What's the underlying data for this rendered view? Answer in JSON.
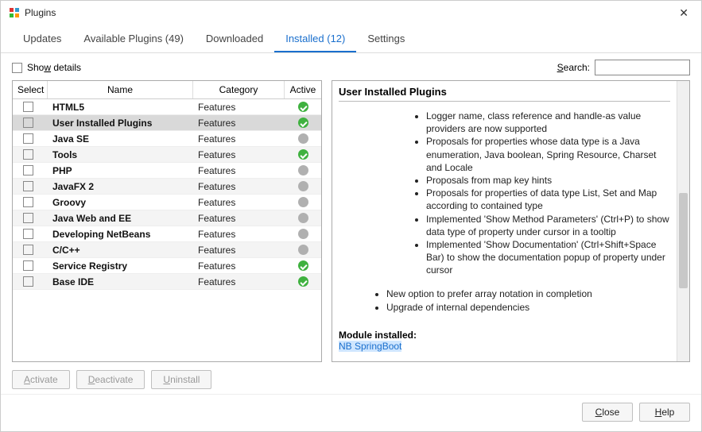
{
  "window": {
    "title": "Plugins"
  },
  "tabs": [
    {
      "label": "Updates"
    },
    {
      "label": "Available Plugins (49)"
    },
    {
      "label": "Downloaded"
    },
    {
      "label": "Installed (12)",
      "active": true
    },
    {
      "label": "Settings"
    }
  ],
  "showDetails": {
    "label_pre": "Sho",
    "label_u": "w",
    "label_post": " details"
  },
  "search": {
    "label_pre": "",
    "label_u": "S",
    "label_post": "earch:",
    "value": ""
  },
  "table": {
    "headers": {
      "select": "Select",
      "name": "Name",
      "category": "Category",
      "active": "Active"
    },
    "rows": [
      {
        "name": "HTML5",
        "category": "Features",
        "active": "green"
      },
      {
        "name": "User Installed Plugins",
        "category": "Features",
        "active": "green",
        "selected": true
      },
      {
        "name": "Java SE",
        "category": "Features",
        "active": "gray"
      },
      {
        "name": "Tools",
        "category": "Features",
        "active": "green"
      },
      {
        "name": "PHP",
        "category": "Features",
        "active": "gray"
      },
      {
        "name": "JavaFX 2",
        "category": "Features",
        "active": "gray"
      },
      {
        "name": "Groovy",
        "category": "Features",
        "active": "gray"
      },
      {
        "name": "Java Web and EE",
        "category": "Features",
        "active": "gray"
      },
      {
        "name": "Developing NetBeans",
        "category": "Features",
        "active": "gray"
      },
      {
        "name": "C/C++",
        "category": "Features",
        "active": "gray"
      },
      {
        "name": "Service Registry",
        "category": "Features",
        "active": "green"
      },
      {
        "name": "Base IDE",
        "category": "Features",
        "active": "green"
      }
    ]
  },
  "details": {
    "title": "User Installed Plugins",
    "bullets_inner": [
      "Logger name, class reference and handle-as value providers are now supported",
      "Proposals for properties whose data type is a Java enumeration, Java boolean, Spring Resource, Charset and Locale",
      "Proposals from map key hints",
      "Proposals for properties of data type List, Set and Map according to contained type",
      "Implemented 'Show Method Parameters' (Ctrl+P) to show data type of property under cursor in a tooltip",
      "Implemented 'Show Documentation' (Ctrl+Shift+Space Bar) to show the documentation popup of property under cursor"
    ],
    "bullets_outer": [
      "New option to prefer array notation in completion",
      "Upgrade of internal dependencies"
    ],
    "module_label": "Module installed:",
    "module_name": "NB SpringBoot"
  },
  "actions": {
    "activate_u": "A",
    "activate_post": "ctivate",
    "deactivate_u": "D",
    "deactivate_post": "eactivate",
    "uninstall_u": "U",
    "uninstall_post": "ninstall"
  },
  "footer": {
    "close_u": "C",
    "close_post": "lose",
    "help_u": "H",
    "help_post": "elp"
  }
}
